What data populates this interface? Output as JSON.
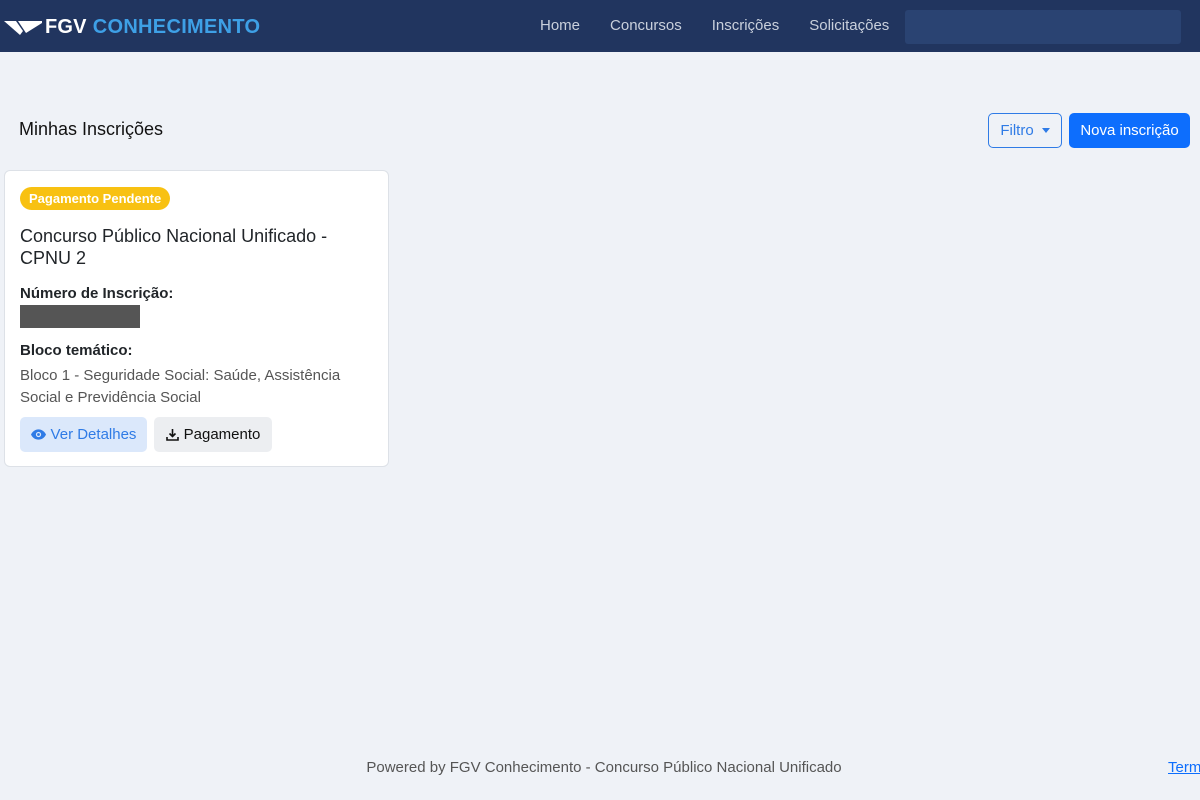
{
  "brand": {
    "name_part1": "FGV",
    "name_part2": "CONHECIMENTO",
    "logo_icon": "fgv-logo-icon"
  },
  "nav": {
    "items": [
      {
        "label": "Home"
      },
      {
        "label": "Concursos"
      },
      {
        "label": "Inscrições"
      },
      {
        "label": "Solicitações"
      }
    ]
  },
  "page": {
    "title": "Minhas Inscrições",
    "filter_label": "Filtro",
    "new_label": "Nova inscrição"
  },
  "card": {
    "status": "Pagamento Pendente",
    "title": "Concurso Público Nacional Unificado - CPNU 2",
    "number_label": "Número de Inscrição:",
    "block_label": "Bloco temático:",
    "block_value": "Bloco 1 - Seguridade Social: Saúde, Assistência Social e Previdência Social",
    "details_label": "Ver Detalhes",
    "payment_label": "Pagamento"
  },
  "footer": {
    "text": "Powered by FGV Conhecimento - Concurso Público Nacional Unificado",
    "link": "Term"
  },
  "colors": {
    "navbar": "#21355f",
    "accent": "#0d6efd",
    "badge_pending": "#f8c112",
    "background": "#eff2f7"
  }
}
